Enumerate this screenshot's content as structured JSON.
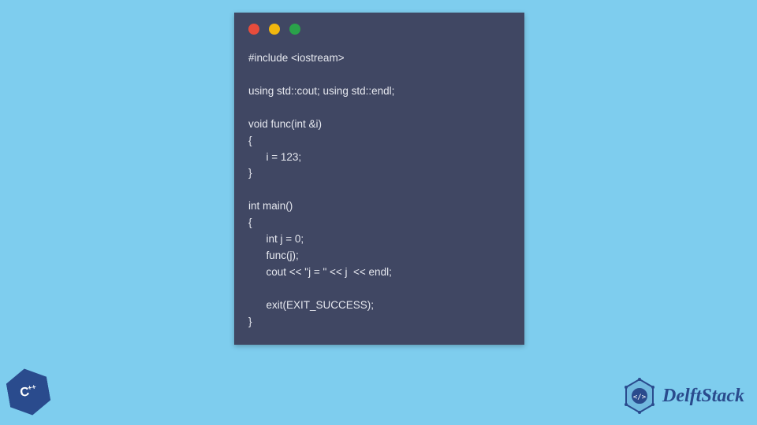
{
  "window": {
    "traffic_lights": [
      "red",
      "yellow",
      "green"
    ]
  },
  "code": {
    "content": "#include <iostream>\n\nusing std::cout; using std::endl;\n\nvoid func(int &i)\n{\n      i = 123;\n}\n\nint main()\n{\n      int j = 0;\n      func(j);\n      cout << \"j = \" << j  << endl;\n\n      exit(EXIT_SUCCESS);\n}"
  },
  "badges": {
    "cpp_label": "C",
    "cpp_plus": "++"
  },
  "brand": {
    "name": "DelftStack"
  }
}
